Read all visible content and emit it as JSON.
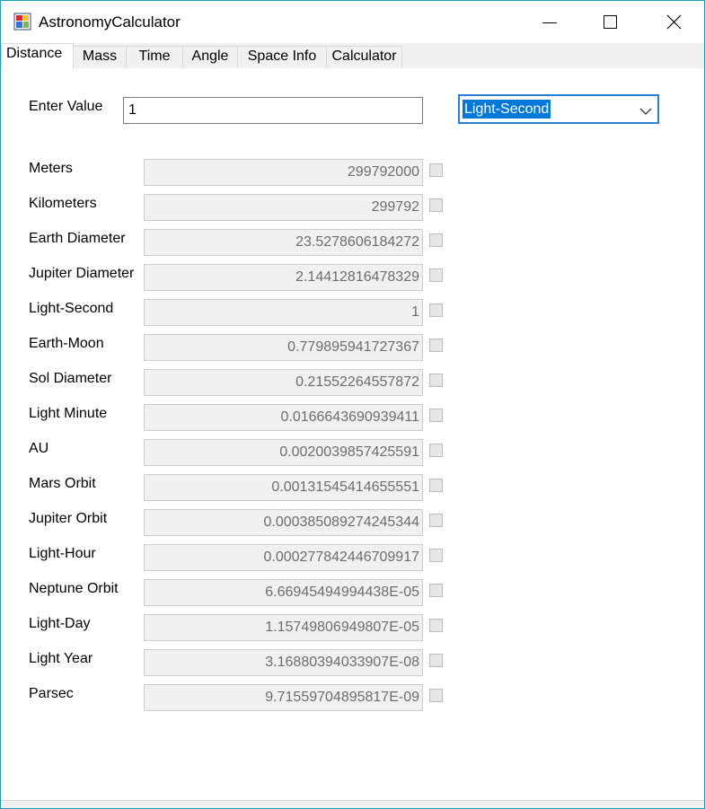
{
  "window": {
    "title": "AstronomyCalculator",
    "accent": "#1a9fb6"
  },
  "tabs": [
    {
      "label": "Distance",
      "active": true
    },
    {
      "label": "Mass",
      "active": false
    },
    {
      "label": "Time",
      "active": false
    },
    {
      "label": "Angle",
      "active": false
    },
    {
      "label": "Space Info",
      "active": false
    },
    {
      "label": "Calculator",
      "active": false
    }
  ],
  "input": {
    "label": "Enter Value",
    "value": "1"
  },
  "unit_select": {
    "selected": "Light-Second",
    "highlight_color": "#0078d7"
  },
  "rows": [
    {
      "label": "Meters",
      "value": "299792000"
    },
    {
      "label": "Kilometers",
      "value": "299792"
    },
    {
      "label": "Earth Diameter",
      "value": "23.5278606184272"
    },
    {
      "label": "Jupiter Diameter",
      "value": "2.14412816478329"
    },
    {
      "label": "Light-Second",
      "value": "1"
    },
    {
      "label": "Earth-Moon",
      "value": "0.779895941727367"
    },
    {
      "label": "Sol Diameter",
      "value": "0.21552264557872"
    },
    {
      "label": "Light Minute",
      "value": "0.0166643690939411"
    },
    {
      "label": "AU",
      "value": "0.0020039857425591"
    },
    {
      "label": "Mars Orbit",
      "value": "0.00131545414655551"
    },
    {
      "label": "Jupiter Orbit",
      "value": "0.000385089274245344"
    },
    {
      "label": "Light-Hour",
      "value": "0.000277842446709917"
    },
    {
      "label": "Neptune Orbit",
      "value": "6.66945494994438E-05"
    },
    {
      "label": "Light-Day",
      "value": "1.15749806949807E-05"
    },
    {
      "label": "Light Year",
      "value": "3.16880394033907E-08"
    },
    {
      "label": "Parsec",
      "value": "9.71559704895817E-09"
    }
  ],
  "icons": {
    "app": "app-icon",
    "minimize": "minimize-icon",
    "maximize": "maximize-icon",
    "close": "close-icon",
    "dropdown": "chevron-down-icon"
  }
}
